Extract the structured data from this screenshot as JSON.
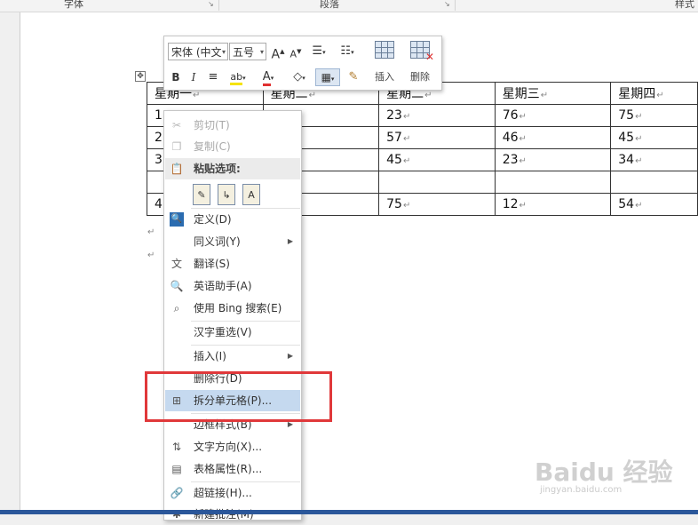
{
  "ribbon": {
    "group_font": "字体",
    "group_paragraph": "段落",
    "group_styles": "样式"
  },
  "table": {
    "rows": [
      [
        "星期一",
        "星期二",
        "星期二",
        "星期三",
        "星期四"
      ],
      [
        "1",
        "",
        "23",
        "76",
        "75"
      ],
      [
        "2",
        "",
        "57",
        "46",
        "45"
      ],
      [
        "3",
        "",
        "45",
        "23",
        "34"
      ],
      [
        "",
        "",
        "",
        "",
        ""
      ],
      [
        "4",
        "",
        "75",
        "12",
        "54"
      ]
    ]
  },
  "mini_toolbar": {
    "font_name": "宋体 (中文",
    "font_size": "五号",
    "insert_label": "插入",
    "delete_label": "删除"
  },
  "context_menu": {
    "cut": "剪切(T)",
    "copy": "复制(C)",
    "paste_options": "粘贴选项:",
    "define": "定义(D)",
    "synonyms": "同义词(Y)",
    "translate": "翻译(S)",
    "english_assistant": "英语助手(A)",
    "bing_search": "使用 Bing 搜索(E)",
    "hanzi_reselect": "汉字重选(V)",
    "insert": "插入(I)",
    "delete_row": "删除行(D)",
    "split_cells": "拆分单元格(P)...",
    "border_styles": "边框样式(B)",
    "text_direction": "文字方向(X)...",
    "table_properties": "表格属性(R)...",
    "hyperlink": "超链接(H)...",
    "new_comment": "新建批注(M)"
  },
  "watermark": {
    "brand": "Baidu 经验",
    "url": "jingyan.baidu.com"
  },
  "colors": {
    "highlight": "#c5d9ef",
    "annotation_box": "#e0383a",
    "status_bar": "#2b579a"
  }
}
